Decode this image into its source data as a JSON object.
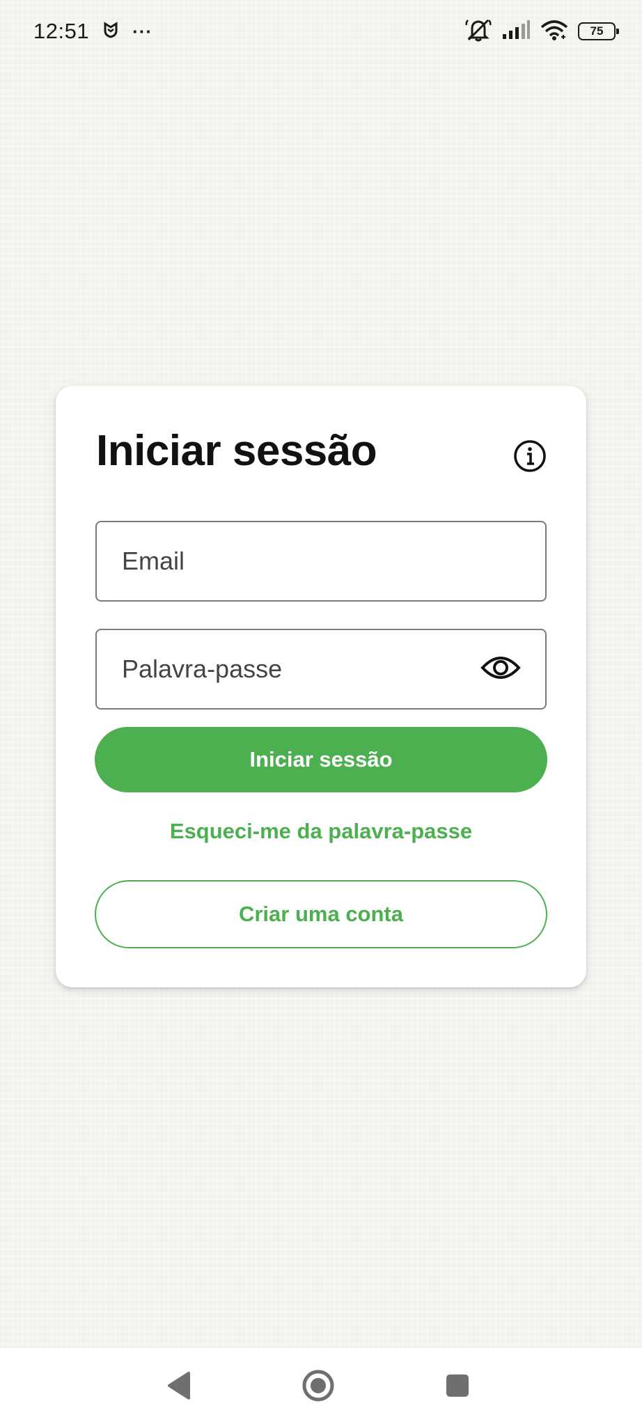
{
  "status_bar": {
    "time": "12:51",
    "more_indicator": "···",
    "battery_level": "75",
    "icons": [
      "notification-app-icon",
      "bell-muted-icon",
      "signal-icon",
      "wifi-icon",
      "battery-icon"
    ]
  },
  "login": {
    "title": "Iniciar sessão",
    "email_placeholder": "Email",
    "email_value": "",
    "password_placeholder": "Palavra-passe",
    "password_value": "",
    "submit_label": "Iniciar sessão",
    "forgot_label": "Esqueci-me da palavra-passe",
    "create_account_label": "Criar uma conta"
  },
  "colors": {
    "accent": "#4caf50",
    "background": "#f4f3ef",
    "card": "#ffffff",
    "title_text": "#111111",
    "field_border": "#7a7a7a"
  },
  "nav_bar": {
    "icons": [
      "back-icon",
      "home-icon",
      "recents-icon"
    ]
  }
}
